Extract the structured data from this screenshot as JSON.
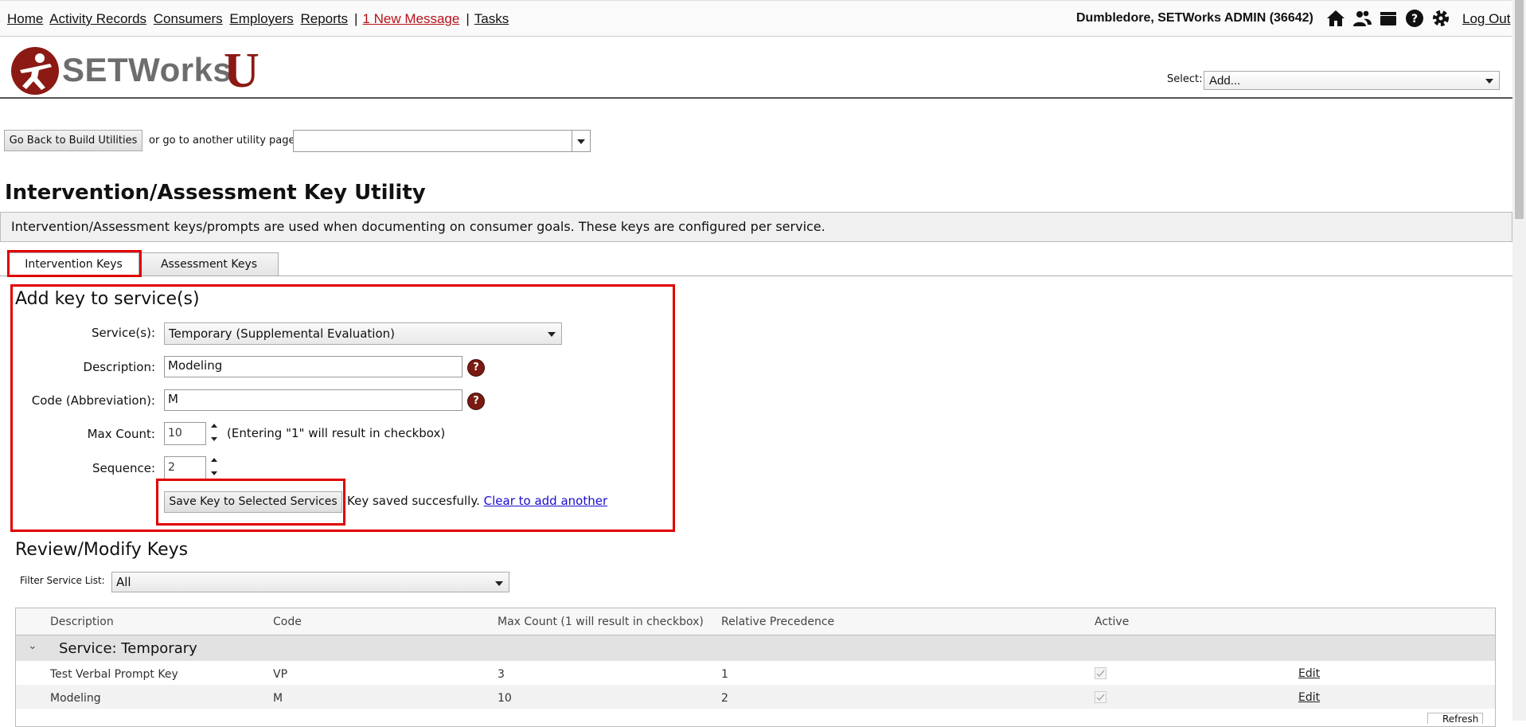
{
  "topnav": {
    "links": [
      "Home",
      "Activity Records",
      "Consumers",
      "Employers",
      "Reports"
    ],
    "message_link": "1 New Message",
    "tasks_link": "Tasks",
    "user": "Dumbledore, SETWorks ADMIN",
    "user_id": "(36642)",
    "logout": "Log Out",
    "icons": [
      "home-icon",
      "users-icon",
      "folder-icon",
      "help-icon",
      "gear-icon"
    ]
  },
  "header": {
    "logo_text": "SETWorks",
    "logo_u": "U",
    "select_label": "Select:",
    "select_value": "Add..."
  },
  "utility_nav": {
    "back_button": "Go Back to Build Utilities",
    "or_text": "or go to another utility page:",
    "select_value": ""
  },
  "page": {
    "title": "Intervention/Assessment Key Utility",
    "info": "Intervention/Assessment keys/prompts are used when documenting on consumer goals. These keys are configured per service."
  },
  "tabs": [
    "Intervention Keys",
    "Assessment Keys"
  ],
  "add_form": {
    "heading": "Add key to service(s)",
    "service_label": "Service(s):",
    "service_value": "Temporary (Supplemental Evaluation)",
    "description_label": "Description:",
    "description_value": "Modeling",
    "code_label": "Code (Abbreviation):",
    "code_value": "M",
    "max_count_label": "Max Count:",
    "max_count_value": "10",
    "max_count_note": "(Entering \"1\" will result in checkbox)",
    "sequence_label": "Sequence:",
    "sequence_value": "2",
    "save_button": "Save Key to Selected Services",
    "status_text": "Key saved succesfully.",
    "clear_link": "Clear to add another"
  },
  "review": {
    "heading": "Review/Modify Keys",
    "filter_label": "Filter Service List:",
    "filter_value": "All",
    "columns": [
      "Description",
      "Code",
      "Max Count (1 will result in checkbox)",
      "Relative Precedence",
      "Active"
    ],
    "group_title": "Service: Temporary",
    "rows": [
      {
        "description": "Test Verbal Prompt Key",
        "code": "VP",
        "max_count": "3",
        "precedence": "1",
        "active": true,
        "action": "Edit"
      },
      {
        "description": "Modeling",
        "code": "M",
        "max_count": "10",
        "precedence": "2",
        "active": true,
        "action": "Edit"
      }
    ],
    "refresh": "Refresh"
  },
  "colors": {
    "accent": "#b5121b",
    "brand": "#8b1a14",
    "highlight": "#e00000"
  }
}
